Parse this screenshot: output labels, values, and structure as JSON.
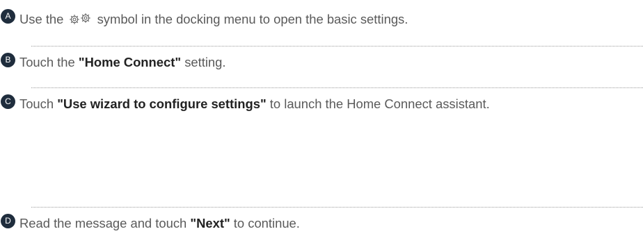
{
  "steps": [
    {
      "letter": "A",
      "parts": {
        "pre": "Use the ",
        "post": " symbol in the docking menu to open the basic settings."
      },
      "icon": "gear-icon"
    },
    {
      "letter": "B",
      "parts": {
        "pre": "Touch the ",
        "bold": "\"Home Connect\"",
        "post": " setting."
      }
    },
    {
      "letter": "C",
      "parts": {
        "pre": "Touch ",
        "bold": "\"Use wizard to configure settings\"",
        "post": " to launch the Home Connect assistant."
      }
    },
    {
      "letter": "D",
      "parts": {
        "pre": "Read the message and touch ",
        "bold": "\"Next\"",
        "post": " to continue."
      }
    }
  ],
  "colors": {
    "badge": "#1f2d3d",
    "text": "#5a5a5a",
    "bold_text": "#222222",
    "divider": "#9a9a9a"
  }
}
